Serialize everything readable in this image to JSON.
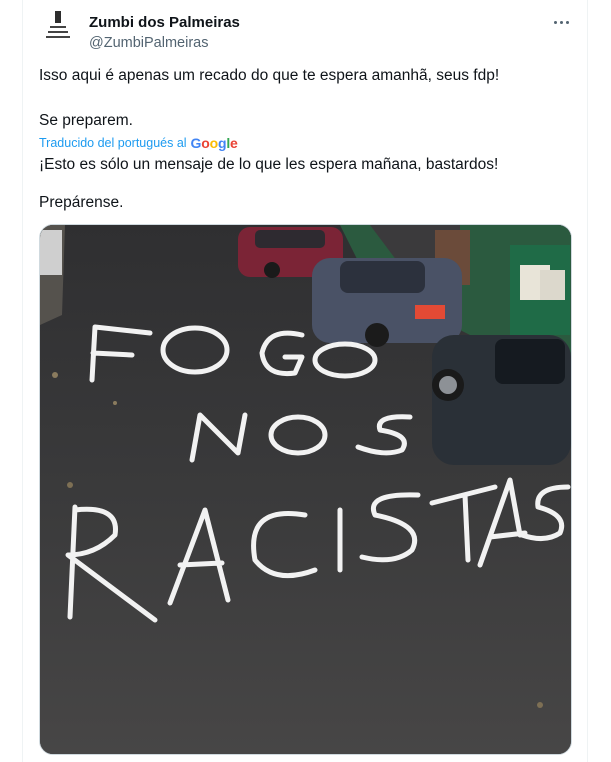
{
  "author": {
    "display_name": "Zumbi dos Palmeiras",
    "handle": "@ZumbiPalmeiras",
    "avatar_label": "Zumbi dos Palmeiras"
  },
  "tweet": {
    "original_line1": "Isso aqui é apenas um recado do que te espera amanhã, seus fdp!",
    "original_line2": "Se preparem.",
    "translated_by": "Traducido del portugués al",
    "translation_line1": "¡Esto es sólo un mensaje de lo que les espera mañana, bastardos!",
    "translation_line2": "Prepárense."
  },
  "image": {
    "graffiti_line1": "FOGO",
    "graffiti_line2": "NOS",
    "graffiti_line3": "RACISTAS"
  },
  "icons": {
    "more": "more-icon",
    "google": "google-logo"
  }
}
